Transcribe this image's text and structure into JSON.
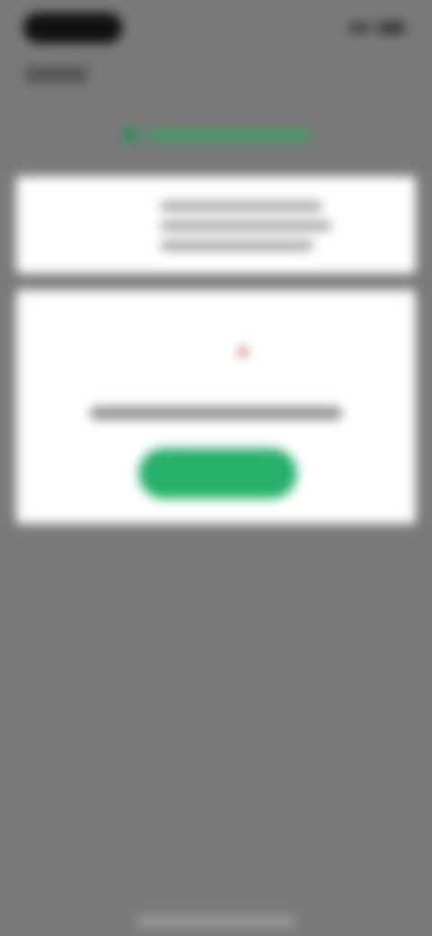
{
  "status_bar": {
    "time": "",
    "right_icons": [
      "signal-icon",
      "battery-icon"
    ]
  },
  "header": {
    "back_label": "",
    "banner_text": ""
  },
  "top_card": {
    "line1": "",
    "line2": "",
    "line3": ""
  },
  "main_card": {
    "message": "",
    "button_label": ""
  },
  "colors": {
    "overlay_gray": "#7a7a7a",
    "button_green": "#27b06a",
    "banner_green": "#3f9e63",
    "accent_red": "#c05050"
  }
}
